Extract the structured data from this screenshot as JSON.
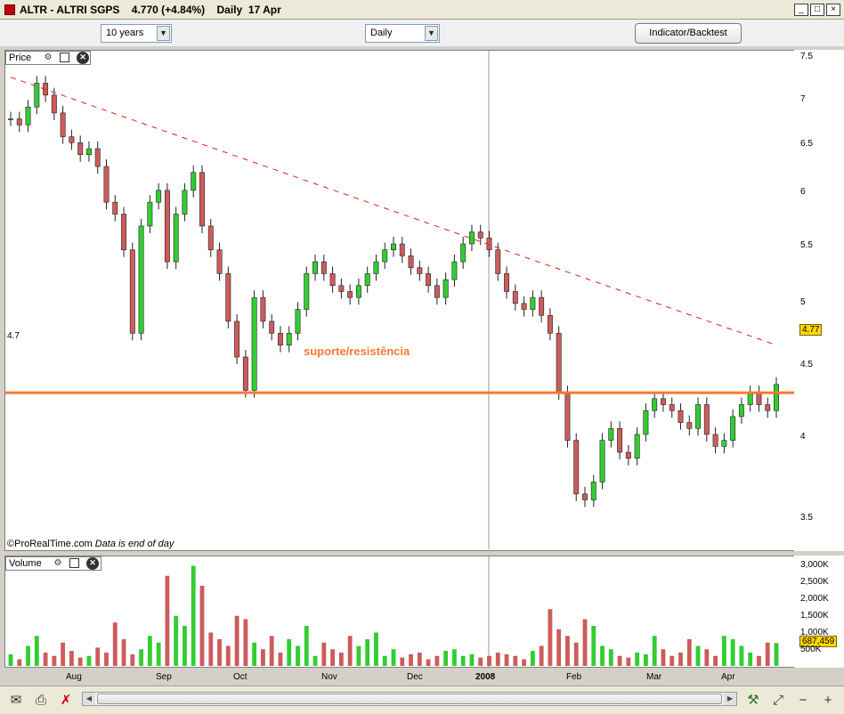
{
  "window": {
    "title": "ALTR - ALTRI SGPS    4.770 (+4.84%)    Daily  17 Apr",
    "min_icon": "minimize-icon",
    "max_icon": "maximize-icon",
    "close_icon": "close-icon",
    "min_glyph": "_",
    "max_glyph": "□",
    "close_glyph": "×"
  },
  "toolbar": {
    "period": "10 years",
    "interval": "Daily",
    "indicator_button": "Indicator/Backtest"
  },
  "price_panel": {
    "label": "Price",
    "support_value": "4.7",
    "support_label": "suporte/resistência",
    "last_price_tag": "4.77",
    "copyright": "©ProRealTime.com",
    "data_note": "Data is end of day",
    "y_ticks": [
      "7.5",
      "7",
      "6.5",
      "6",
      "5.5",
      "5",
      "4.5",
      "4",
      "3.5"
    ]
  },
  "volume_panel": {
    "label": "Volume",
    "last_volume_tag": "687,459",
    "y_ticks": [
      "3,000K",
      "2,500K",
      "2,000K",
      "1,500K",
      "1,000K",
      "500K"
    ]
  },
  "x_axis": {
    "labels": [
      "Aug",
      "Sep",
      "Oct",
      "Nov",
      "Dec",
      "2008",
      "Feb",
      "Mar",
      "Apr"
    ]
  },
  "colors": {
    "up": "#32cd32",
    "down": "#cd5c5c",
    "support_line": "#f47a30",
    "trend_line": "#d42020",
    "price_tag_bg": "#ffd700"
  },
  "chart_data": {
    "type": "candlestick",
    "series": [
      {
        "name": "Price",
        "close": [
          7.0,
          6.95,
          7.1,
          7.3,
          7.2,
          7.05,
          6.85,
          6.8,
          6.7,
          6.75,
          6.6,
          6.3,
          6.2,
          5.9,
          5.2,
          6.1,
          6.3,
          6.4,
          5.8,
          6.2,
          6.4,
          6.55,
          6.1,
          5.9,
          5.7,
          5.3,
          5.0,
          4.72,
          5.5,
          5.3,
          5.2,
          5.1,
          5.2,
          5.4,
          5.7,
          5.8,
          5.7,
          5.6,
          5.55,
          5.5,
          5.6,
          5.7,
          5.8,
          5.9,
          5.95,
          5.85,
          5.75,
          5.7,
          5.6,
          5.5,
          5.65,
          5.8,
          5.95,
          6.05,
          6.0,
          5.9,
          5.7,
          5.55,
          5.45,
          5.4,
          5.5,
          5.35,
          5.2,
          4.7,
          4.3,
          3.85,
          3.8,
          3.95,
          4.3,
          4.4,
          4.2,
          4.15,
          4.35,
          4.55,
          4.65,
          4.6,
          4.55,
          4.45,
          4.4,
          4.6,
          4.35,
          4.25,
          4.3,
          4.5,
          4.6,
          4.7,
          4.6,
          4.55,
          4.77
        ]
      },
      {
        "name": "Volume",
        "values": [
          350,
          200,
          600,
          900,
          400,
          300,
          700,
          450,
          250,
          300,
          550,
          400,
          1300,
          800,
          350,
          500,
          900,
          700,
          2700,
          1500,
          1200,
          3000,
          2400,
          1000,
          800,
          600,
          1500,
          1400,
          700,
          500,
          900,
          400,
          800,
          600,
          1200,
          300,
          700,
          500,
          400,
          900,
          600,
          800,
          1000,
          300,
          500,
          250,
          350,
          400,
          200,
          300,
          450,
          500,
          300,
          350,
          250,
          300,
          400,
          350,
          300,
          200,
          450,
          600,
          1700,
          1100,
          900,
          700,
          1400,
          1200,
          600,
          500,
          300,
          250,
          400,
          350,
          900,
          500,
          300,
          400,
          800,
          600,
          500,
          300,
          900,
          800,
          600,
          400,
          300,
          700,
          687
        ]
      }
    ],
    "x_labels": [
      "Aug",
      "Sep",
      "Oct",
      "Nov",
      "Dec",
      "2008",
      "Feb",
      "Mar",
      "Apr"
    ],
    "ylim": [
      3.4,
      7.55
    ],
    "volume_ylim": [
      0,
      3200
    ],
    "support_level": 4.7,
    "support_label": "suporte/resistência",
    "trendline": [
      [
        0,
        7.35
      ],
      [
        88,
        5.1
      ]
    ],
    "legend": "none"
  },
  "bottom_bar": {
    "icons": [
      "mail-icon",
      "print-icon",
      "delete-drawing-icon",
      "chart-settings-icon",
      "zoom-fit-icon",
      "zoom-out-icon",
      "zoom-in-icon"
    ],
    "glyphs": [
      "✉",
      "⎙",
      "✗",
      "⚒",
      "⤢",
      "−",
      "+"
    ]
  }
}
